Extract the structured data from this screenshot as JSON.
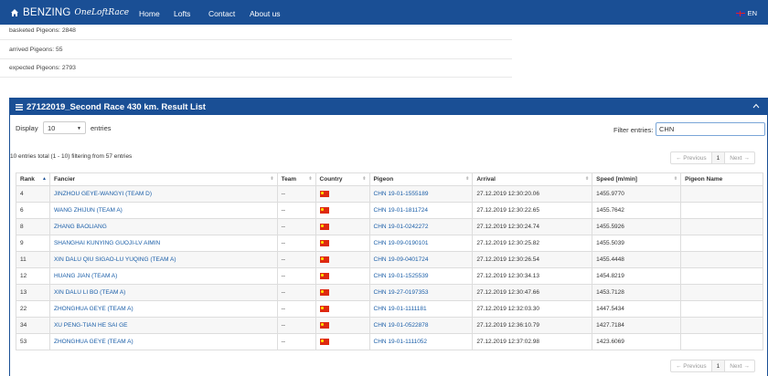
{
  "nav": {
    "brand": "BENZING",
    "brand_script": "OneLoftRace",
    "links": [
      "Home",
      "Lofts",
      "Contact",
      "About us"
    ],
    "lang": "EN"
  },
  "stats": {
    "basketed": "basketed Pigeons:  2848",
    "arrived": "arrived Pigeons:  55",
    "expected": "expected Pigeons:  2793"
  },
  "panel": {
    "title": "27122019_Second Race 430 km. Result List"
  },
  "controls": {
    "display_label": "Display",
    "display_value": "10",
    "entries_label": "entries",
    "filter_label": "Filter entries:",
    "filter_value": "CHN",
    "info": "10 entries total (1 - 10) filtering from 57 entries"
  },
  "pager": {
    "prev": "← Previous",
    "current": "1",
    "next": "Next →"
  },
  "table": {
    "columns": [
      "Rank",
      "Fancier",
      "Team",
      "Country",
      "Pigeon",
      "Arrival",
      "Speed [m/min]",
      "Pigeon Name"
    ],
    "rows": [
      {
        "rank": "4",
        "fancier": "JINZHOU GEYE-WANGYI (TEAM D)",
        "team": "--",
        "pigeon": "CHN 19-01-1555189",
        "arrival": "27.12.2019 12:30:20.06",
        "speed": "1455.9770",
        "name": ""
      },
      {
        "rank": "6",
        "fancier": "WANG ZHIJUN (TEAM A)",
        "team": "--",
        "pigeon": "CHN 19-01-1811724",
        "arrival": "27.12.2019 12:30:22.65",
        "speed": "1455.7642",
        "name": ""
      },
      {
        "rank": "8",
        "fancier": "ZHANG BAOLIANG",
        "team": "--",
        "pigeon": "CHN 19-01-0242272",
        "arrival": "27.12.2019 12:30:24.74",
        "speed": "1455.5926",
        "name": ""
      },
      {
        "rank": "9",
        "fancier": "SHANGHAI KUNYING GUOJI-LV AIMIN",
        "team": "--",
        "pigeon": "CHN 19-09-0190101",
        "arrival": "27.12.2019 12:30:25.82",
        "speed": "1455.5039",
        "name": ""
      },
      {
        "rank": "11",
        "fancier": "XIN DALU QIU SIGAO-LU YUQING (TEAM A)",
        "team": "--",
        "pigeon": "CHN 19-09-0401724",
        "arrival": "27.12.2019 12:30:26.54",
        "speed": "1455.4448",
        "name": ""
      },
      {
        "rank": "12",
        "fancier": "HUANG JIAN (TEAM A)",
        "team": "--",
        "pigeon": "CHN 19-01-1525539",
        "arrival": "27.12.2019 12:30:34.13",
        "speed": "1454.8219",
        "name": ""
      },
      {
        "rank": "13",
        "fancier": "XIN DALU LI BO (TEAM A)",
        "team": "--",
        "pigeon": "CHN 19-27-0197353",
        "arrival": "27.12.2019 12:30:47.66",
        "speed": "1453.7128",
        "name": ""
      },
      {
        "rank": "22",
        "fancier": "ZHONGHUA GEYE (TEAM A)",
        "team": "--",
        "pigeon": "CHN 19-01-1111181",
        "arrival": "27.12.2019 12:32:03.30",
        "speed": "1447.5434",
        "name": ""
      },
      {
        "rank": "34",
        "fancier": "XU PENG-TIAN HE SAI GE",
        "team": "--",
        "pigeon": "CHN 19-01-0522878",
        "arrival": "27.12.2019 12:36:10.79",
        "speed": "1427.7184",
        "name": ""
      },
      {
        "rank": "53",
        "fancier": "ZHONGHUA GEYE (TEAM A)",
        "team": "--",
        "pigeon": "CHN 19-01-1111052",
        "arrival": "27.12.2019 12:37:02.98",
        "speed": "1423.6069",
        "name": ""
      }
    ]
  },
  "icons": {
    "home": "home-icon",
    "list": "list-icon",
    "collapse": "chevron-up-icon",
    "flag": "china-flag-icon"
  },
  "colors": {
    "brand": "#1a4f95",
    "link": "#1a5ea8"
  }
}
